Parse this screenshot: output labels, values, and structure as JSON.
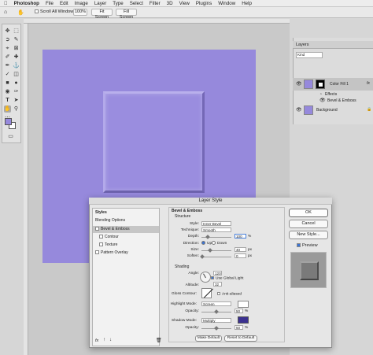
{
  "menubar": {
    "apple": "",
    "app": "Photoshop",
    "items": [
      "File",
      "Edit",
      "Image",
      "Layer",
      "Type",
      "Select",
      "Filter",
      "3D",
      "View",
      "Plugins",
      "Window",
      "Help"
    ]
  },
  "options": {
    "scroll_all": "Scroll All Windows",
    "zoom": "100%",
    "fit": "Fit Screen",
    "fill": "Fill Screen"
  },
  "layers": {
    "tab": "Layers",
    "search": "Kind",
    "rows": [
      {
        "name": "Color Fill 1"
      },
      {
        "name": "Effects"
      },
      {
        "name": "Bevel & Emboss"
      },
      {
        "name": "Background"
      }
    ]
  },
  "dialog": {
    "title": "Layer Style",
    "styles_header": "Styles",
    "styles": [
      "Blending Options",
      "Bevel & Emboss",
      "Contour",
      "Texture",
      "Pattern Overlay"
    ],
    "section": "Bevel & Emboss",
    "structure": "Structure",
    "style_label": "Style:",
    "style_value": "Inner Bevel",
    "technique_label": "Technique:",
    "technique_value": "Smooth",
    "depth_label": "Depth:",
    "depth_value": "100",
    "depth_unit": "%",
    "direction_label": "Direction:",
    "dir_up": "Up",
    "dir_down": "Down",
    "size_label": "Size:",
    "size_value": "40",
    "size_unit": "px",
    "soften_label": "Soften:",
    "soften_value": "0",
    "soften_unit": "px",
    "shading": "Shading",
    "angle_label": "Angle:",
    "angle_value": "120",
    "global_light": "Use Global Light",
    "altitude_label": "Altitude:",
    "altitude_value": "32",
    "gloss_label": "Gloss Contour:",
    "antialiased": "Anti-aliased",
    "highlight_label": "Highlight Mode:",
    "highlight_value": "Screen",
    "hl_opacity_label": "Opacity:",
    "hl_opacity_value": "50",
    "shadow_label": "Shadow Mode:",
    "shadow_value": "Multiply",
    "sh_opacity_label": "Opacity:",
    "sh_opacity_value": "50",
    "make_default": "Make Default",
    "reset_default": "Reset to Default",
    "ok": "OK",
    "cancel": "Cancel",
    "new_style": "New Style...",
    "preview": "Preview",
    "fx": "fx"
  },
  "colors": {
    "fill": "#9689dc",
    "shadow_swatch": "#3b3190",
    "highlight_swatch": "#ffffff"
  }
}
